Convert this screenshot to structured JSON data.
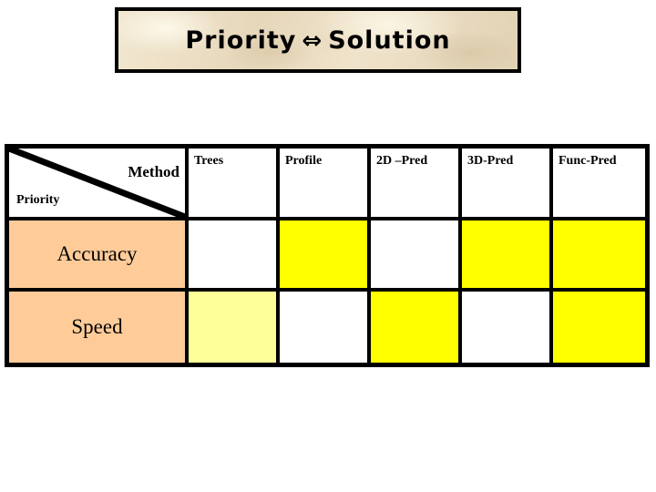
{
  "slide": {
    "title": {
      "left_word": "Priority",
      "arrow": "⇔",
      "right_word": "Solution",
      "full": "Priority ⇔ Solution"
    }
  },
  "table": {
    "corner": {
      "method_label": "Method",
      "priority_label": "Priority"
    },
    "column_headers": [
      "Trees",
      "Profile",
      "2D –Pred",
      "3D-Pred",
      "Func-Pred"
    ],
    "row_headers": [
      "Accuracy",
      "Speed"
    ],
    "rows": [
      {
        "label": "Accuracy",
        "cells": [
          {
            "column": "Trees",
            "fill": "white"
          },
          {
            "column": "Profile",
            "fill": "yellow"
          },
          {
            "column": "2D –Pred",
            "fill": "white"
          },
          {
            "column": "3D-Pred",
            "fill": "yellow"
          },
          {
            "column": "Func-Pred",
            "fill": "yellow"
          }
        ]
      },
      {
        "label": "Speed",
        "cells": [
          {
            "column": "Trees",
            "fill": "pale-yellow"
          },
          {
            "column": "Profile",
            "fill": "white"
          },
          {
            "column": "2D –Pred",
            "fill": "yellow"
          },
          {
            "column": "3D-Pred",
            "fill": "white"
          },
          {
            "column": "Func-Pred",
            "fill": "yellow"
          }
        ]
      }
    ]
  },
  "colors": {
    "yellow": "#FFFF00",
    "pale_yellow": "#FFFF99",
    "white": "#FFFFFF",
    "row_header_peach": "#FFCC99",
    "border_black": "#000000",
    "banner_parchment": "#EBDEC4",
    "text_black": "#000000"
  }
}
